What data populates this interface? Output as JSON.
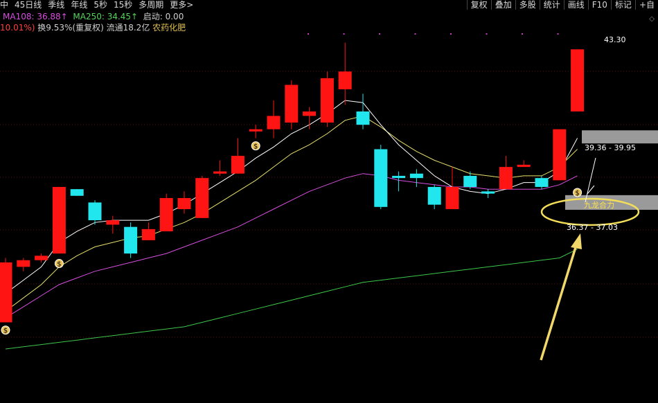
{
  "topbar": {
    "left_items": [
      "中",
      "45日线",
      "季线",
      "年线",
      "5秒",
      "15秒",
      "多周期",
      "更多>"
    ],
    "right_buttons": [
      "复权",
      "叠加",
      "多股",
      "统计",
      "画线",
      "F10",
      "标记",
      "+自"
    ]
  },
  "legend": {
    "ma108_label": "MA108: 36.88↑",
    "ma250_label": "MA250: 34.45↑",
    "startup_label": "启动: 0.00",
    "change_pct": "10.01%)",
    "turnover": "换9.53%(重复权)",
    "float": "流通18.2亿",
    "stock_name": "农药化肥"
  },
  "annotations": {
    "high_price": "43.30",
    "range_upper": "39.36 - 39.95",
    "range_lower": "36.37 - 37.03",
    "signal_text": "九龙合力"
  },
  "colors": {
    "up": "#ff1414",
    "down": "#22e6ee",
    "ma_white": "#ffffff",
    "ma_yellow": "#e8e06a",
    "ma_magenta": "#d84ee0",
    "ma_green": "#3cc84a",
    "highlight_ellipse": "#f2de58",
    "arrow": "#f2d86a",
    "gap_band": "#9a9a9a"
  },
  "chart_data": {
    "type": "candlestick",
    "candles": [
      {
        "open": 31.3,
        "close": 34.0,
        "high": 34.2,
        "low": 31.3
      },
      {
        "open": 33.8,
        "close": 34.1,
        "high": 34.2,
        "low": 33.6
      },
      {
        "open": 34.1,
        "close": 34.3,
        "high": 34.4,
        "low": 34.0
      },
      {
        "open": 34.4,
        "close": 37.4,
        "high": 37.4,
        "low": 34.4
      },
      {
        "open": 37.3,
        "close": 37.0,
        "high": 37.3,
        "low": 37.0
      },
      {
        "open": 36.7,
        "close": 35.9,
        "high": 36.8,
        "low": 35.7
      },
      {
        "open": 35.7,
        "close": 35.9,
        "high": 36.1,
        "low": 35.3
      },
      {
        "open": 35.6,
        "close": 34.4,
        "high": 35.8,
        "low": 34.2
      },
      {
        "open": 35.0,
        "close": 35.5,
        "high": 35.8,
        "low": 35.0
      },
      {
        "open": 35.4,
        "close": 36.9,
        "high": 37.1,
        "low": 35.4
      },
      {
        "open": 36.4,
        "close": 36.9,
        "high": 37.2,
        "low": 36.2
      },
      {
        "open": 36.0,
        "close": 37.8,
        "high": 37.9,
        "low": 36.0
      },
      {
        "open": 38.0,
        "close": 38.1,
        "high": 38.6,
        "low": 37.9
      },
      {
        "open": 38.0,
        "close": 38.8,
        "high": 39.6,
        "low": 38.0
      },
      {
        "open": 39.9,
        "close": 40.0,
        "high": 40.2,
        "low": 39.6
      },
      {
        "open": 40.0,
        "close": 40.6,
        "high": 41.3,
        "low": 39.6
      },
      {
        "open": 40.3,
        "close": 42.0,
        "high": 42.2,
        "low": 40.0
      },
      {
        "open": 40.6,
        "close": 40.8,
        "high": 41.0,
        "low": 40.0
      },
      {
        "open": 40.3,
        "close": 42.3,
        "high": 42.6,
        "low": 40.1
      },
      {
        "open": 41.8,
        "close": 42.6,
        "high": 43.9,
        "low": 41.1
      },
      {
        "open": 40.8,
        "close": 40.2,
        "high": 41.6,
        "low": 40.0
      },
      {
        "open": 39.1,
        "close": 36.5,
        "high": 39.3,
        "low": 36.4
      },
      {
        "open": 37.9,
        "close": 37.8,
        "high": 38.1,
        "low": 37.2
      },
      {
        "open": 38.0,
        "close": 37.8,
        "high": 38.2,
        "low": 37.4
      },
      {
        "open": 37.4,
        "close": 36.6,
        "high": 37.5,
        "low": 36.4
      },
      {
        "open": 36.4,
        "close": 37.4,
        "high": 38.3,
        "low": 36.4
      },
      {
        "open": 37.9,
        "close": 37.4,
        "high": 38.1,
        "low": 37.3
      },
      {
        "open": 37.2,
        "close": 37.1,
        "high": 37.3,
        "low": 36.9
      },
      {
        "open": 37.3,
        "close": 38.3,
        "high": 38.8,
        "low": 37.3
      },
      {
        "open": 38.3,
        "close": 38.4,
        "high": 38.6,
        "low": 38.3
      },
      {
        "open": 37.8,
        "close": 37.4,
        "high": 37.9,
        "low": 37.3
      },
      {
        "open": 37.7,
        "close": 40.0,
        "high": 40.0,
        "low": 37.7
      },
      {
        "open": 40.8,
        "close": 43.6,
        "high": 43.6,
        "low": 40.8
      }
    ],
    "ma_white": [
      32.6,
      33.2,
      33.8,
      34.9,
      35.4,
      35.8,
      35.9,
      35.9,
      35.9,
      36.2,
      36.6,
      37.1,
      37.6,
      38.1,
      38.7,
      39.2,
      39.8,
      40.2,
      40.7,
      41.3,
      41.2,
      40.2,
      39.3,
      38.6,
      37.9,
      37.4,
      37.2,
      37.1,
      37.3,
      37.6,
      37.6,
      38.1,
      39.6
    ],
    "ma_yellow": [
      31.8,
      32.4,
      33.0,
      33.8,
      34.3,
      34.7,
      34.9,
      35.1,
      35.2,
      35.5,
      35.8,
      36.2,
      36.7,
      37.2,
      37.7,
      38.3,
      38.9,
      39.3,
      39.8,
      40.4,
      40.6,
      40.1,
      39.5,
      39.0,
      38.6,
      38.3,
      38.0,
      37.9,
      37.8,
      37.9,
      37.9,
      38.3,
      39.1
    ],
    "ma_magenta": [
      31.5,
      32.0,
      32.5,
      33.0,
      33.3,
      33.6,
      33.8,
      34.0,
      34.2,
      34.4,
      34.7,
      35.0,
      35.3,
      35.6,
      36.0,
      36.4,
      36.8,
      37.2,
      37.5,
      37.8,
      38.0,
      37.9,
      37.7,
      37.6,
      37.5,
      37.4,
      37.4,
      37.3,
      37.3,
      37.3,
      37.3,
      37.5,
      37.9
    ],
    "ma_green": [
      30.1,
      30.2,
      30.3,
      30.4,
      30.5,
      30.6,
      30.7,
      30.8,
      30.9,
      31.0,
      31.1,
      31.3,
      31.5,
      31.7,
      31.9,
      32.1,
      32.3,
      32.5,
      32.7,
      32.9,
      33.1,
      33.2,
      33.3,
      33.4,
      33.5,
      33.6,
      33.7,
      33.8,
      33.9,
      34.0,
      34.1,
      34.2,
      34.6
    ],
    "y_range": [
      29.6,
      44.2
    ]
  }
}
